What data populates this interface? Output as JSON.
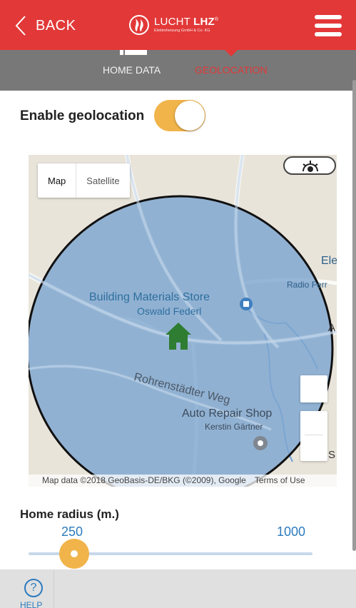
{
  "header": {
    "back_label": "BACK",
    "brand_name": "LUCHT",
    "brand_bold": "LHZ",
    "brand_mark": "®",
    "brand_sub": "Elektroheizung GmbH & Co. KG",
    "accent_color": "#e23838"
  },
  "tabs": {
    "home_label": "HOME DATA",
    "geo_label": "GEOLOCATION",
    "active": "GEOLOCATION"
  },
  "geolocation": {
    "label": "Enable geolocation",
    "enabled": true,
    "toggle_color": "#f0b44a"
  },
  "map": {
    "type_map": "Map",
    "type_satellite": "Satellite",
    "selected_type": "Map",
    "labels": {
      "store_line1": "Building Materials Store",
      "store_line2": "Oswald Federl",
      "road": "Rohrenstädter Weg",
      "auto_line1": "Auto Repair Shop",
      "auto_line2": "Kerstin Gärtner",
      "edge_elec": "Electr",
      "edge_radio": "Radio Ferr",
      "edge_a": "A",
      "edge_s": "S"
    },
    "attribution": "Map data ©2018 GeoBasis-DE/BKG (©2009), Google",
    "terms": "Terms of Use",
    "home_icon": "house-icon",
    "home_color": "#2e7d32",
    "radius_fill": "#7ea6cf"
  },
  "radius": {
    "label": "Home radius (m.)",
    "current_value": "250",
    "max_value": "1000",
    "slider_fraction": 0.25
  },
  "bottom": {
    "help_icon": "?",
    "help_label": "HELP"
  }
}
